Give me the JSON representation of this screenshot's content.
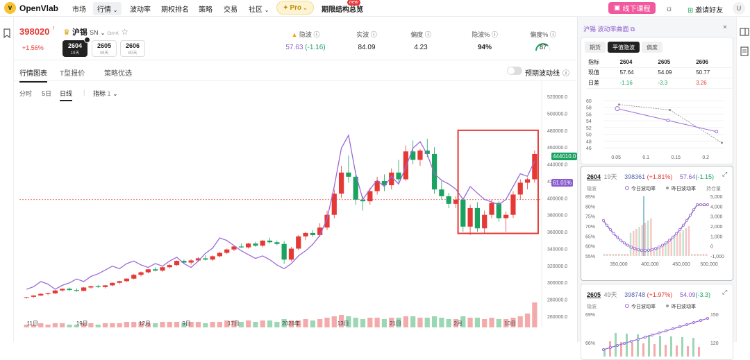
{
  "nav": {
    "logo_mark": "v",
    "logo": "OpenVlab",
    "items": [
      "市场",
      "行情",
      "波动率",
      "期权排名",
      "策略",
      "交易",
      "社区"
    ],
    "pro": "Pro",
    "special": "期限结构总览",
    "new_badge": "new",
    "course": "线下课程",
    "invite": "邀请好友",
    "avatar": "U"
  },
  "quote": {
    "price": "398020",
    "arrow": "↑",
    "change": "+1.56%",
    "symbol": "沪锡",
    "code": "SN",
    "hotkey": "Ctrl+K",
    "contracts": [
      {
        "code": "2604",
        "days": "19天"
      },
      {
        "code": "2605",
        "days": "49天"
      },
      {
        "code": "2606",
        "days": "80天"
      }
    ],
    "metrics": [
      {
        "label": "隐波",
        "value": "57.63",
        "delta": "(-1.16)"
      },
      {
        "label": "实波",
        "value": "84.09"
      },
      {
        "label": "偏度",
        "value": "4.23"
      },
      {
        "label": "隐波%",
        "value": "94%"
      },
      {
        "label": "偏度%",
        "value": "87"
      }
    ]
  },
  "tabs": [
    "行情图表",
    "T型报价",
    "策略优选"
  ],
  "toggle_label": "预期波动线",
  "timeframes": [
    "分时",
    "5日",
    "日线"
  ],
  "indicator": {
    "label": "指标",
    "count": "1"
  },
  "chart_data": {
    "type": "candlestick",
    "y_ticks": [
      "520000.0",
      "500000.0",
      "480000.0",
      "460000.0",
      "440000.0",
      "420000.0",
      "400000.0",
      "380000.0",
      "360000.0",
      "340000.0",
      "320000.0",
      "300000.0",
      "280000.0",
      "260000.0"
    ],
    "x_labels": [
      "11日",
      "19日",
      "12月",
      "9日",
      "17日",
      "2026年",
      "13日",
      "21日",
      "2月",
      "10日"
    ],
    "price_tag": "444010.0",
    "iv_tag": "61.01%",
    "ylim": [
      255000,
      525000
    ],
    "ref_price": 398020,
    "ohlc": [
      [
        282000,
        283000,
        281000,
        282500
      ],
      [
        283000,
        285000,
        282000,
        284500
      ],
      [
        284500,
        287000,
        284000,
        286500
      ],
      [
        286500,
        288000,
        285000,
        287000
      ],
      [
        287000,
        291000,
        286500,
        290500
      ],
      [
        290500,
        293000,
        289000,
        292500
      ],
      [
        292500,
        294000,
        290000,
        291000
      ],
      [
        291000,
        293000,
        289000,
        290000
      ],
      [
        290000,
        294500,
        289500,
        294000
      ],
      [
        294000,
        296000,
        292500,
        295500
      ],
      [
        295500,
        297000,
        293500,
        294500
      ],
      [
        294500,
        297000,
        293000,
        296500
      ],
      [
        296500,
        300000,
        295500,
        299500
      ],
      [
        299500,
        302000,
        298000,
        301500
      ],
      [
        301500,
        305000,
        300500,
        304500
      ],
      [
        304500,
        310000,
        303500,
        309000
      ],
      [
        309000,
        313000,
        307000,
        312000
      ],
      [
        312000,
        316000,
        310500,
        315500
      ],
      [
        315500,
        318000,
        313000,
        314000
      ],
      [
        314000,
        319000,
        312500,
        318000
      ],
      [
        318000,
        322000,
        316500,
        320500
      ],
      [
        320500,
        326000,
        319500,
        325500
      ],
      [
        325500,
        327000,
        322500,
        323500
      ],
      [
        323500,
        327500,
        321000,
        326000
      ],
      [
        326000,
        330000,
        324000,
        328500
      ],
      [
        328500,
        332000,
        326000,
        327000
      ],
      [
        327000,
        332000,
        325500,
        331000
      ],
      [
        331000,
        336000,
        329500,
        335000
      ],
      [
        335000,
        340000,
        333500,
        339000
      ],
      [
        339000,
        343500,
        337000,
        342500
      ],
      [
        342500,
        346000,
        340500,
        341500
      ],
      [
        341500,
        347000,
        340000,
        346000
      ],
      [
        346000,
        348000,
        342000,
        343500
      ],
      [
        343500,
        350000,
        341500,
        349500
      ],
      [
        349500,
        353000,
        346000,
        347500
      ],
      [
        347500,
        349500,
        344000,
        345500
      ],
      [
        345500,
        349000,
        322000,
        327000
      ],
      [
        327000,
        342000,
        325000,
        340000
      ],
      [
        340000,
        356000,
        338000,
        354500
      ],
      [
        354500,
        360000,
        350000,
        358500
      ],
      [
        358500,
        362000,
        354000,
        356000
      ],
      [
        356000,
        370000,
        354000,
        365000
      ],
      [
        365000,
        385000,
        362000,
        380000
      ],
      [
        380000,
        410000,
        376000,
        405000
      ],
      [
        405000,
        438000,
        400000,
        430000
      ],
      [
        430000,
        450000,
        418000,
        425000
      ],
      [
        425000,
        432000,
        392000,
        398000
      ],
      [
        398000,
        402000,
        385000,
        396000
      ],
      [
        396000,
        412000,
        392000,
        408000
      ],
      [
        408000,
        425000,
        404000,
        420000
      ],
      [
        420000,
        428000,
        408000,
        415000
      ],
      [
        415000,
        435000,
        410000,
        430000
      ],
      [
        430000,
        445000,
        418000,
        422000
      ],
      [
        422000,
        462000,
        420000,
        455000
      ],
      [
        455000,
        468000,
        440000,
        445000
      ],
      [
        445000,
        458000,
        438000,
        456000
      ],
      [
        456000,
        470000,
        448000,
        452000
      ],
      [
        452000,
        460000,
        405000,
        410000
      ],
      [
        410000,
        420000,
        398000,
        402000
      ],
      [
        402000,
        406000,
        388000,
        393000
      ],
      [
        393000,
        402000,
        388000,
        398000
      ],
      [
        398000,
        400000,
        360000,
        366000
      ],
      [
        366000,
        392000,
        356000,
        388000
      ],
      [
        388000,
        395000,
        360000,
        364000
      ],
      [
        364000,
        385000,
        358000,
        380000
      ],
      [
        380000,
        398000,
        376000,
        394000
      ],
      [
        394000,
        396000,
        372000,
        376000
      ],
      [
        376000,
        384000,
        360000,
        380000
      ],
      [
        380000,
        408000,
        376000,
        404000
      ],
      [
        404000,
        422000,
        398000,
        418000
      ],
      [
        418000,
        424000,
        410000,
        422000
      ],
      [
        422000,
        456000,
        418000,
        452000
      ]
    ],
    "volumes": [
      2,
      2,
      3,
      2,
      3,
      3,
      2,
      2,
      3,
      3,
      2,
      3,
      3,
      3,
      4,
      4,
      4,
      3,
      3,
      4,
      4,
      4,
      3,
      4,
      4,
      3,
      4,
      4,
      5,
      5,
      4,
      5,
      4,
      5,
      5,
      4,
      6,
      5,
      5,
      6,
      5,
      6,
      7,
      8,
      9,
      8,
      7,
      6,
      7,
      7,
      6,
      7,
      7,
      8,
      8,
      7,
      7,
      8,
      7,
      6,
      6,
      8,
      7,
      7,
      6,
      7,
      6,
      6,
      7,
      8,
      10,
      18
    ],
    "iv_line": [
      30,
      32,
      36,
      34,
      30,
      33,
      35,
      38,
      36,
      40,
      42,
      45,
      48,
      46,
      50,
      52,
      49,
      47,
      50,
      48,
      52,
      55,
      50,
      47,
      52,
      58,
      62,
      70,
      68,
      64,
      60,
      57,
      54,
      56,
      53,
      49,
      46,
      50,
      56,
      60,
      65,
      72,
      85,
      110,
      140,
      150,
      120,
      100,
      108,
      115,
      110,
      118,
      112,
      125,
      140,
      145,
      135,
      120,
      115,
      112,
      108,
      100,
      110,
      105,
      100,
      98,
      96,
      100,
      110,
      120,
      118,
      130
    ]
  },
  "panel": {
    "title": "沪锡 波动率曲面",
    "tabs": [
      "期货",
      "平值隐波",
      "偏度"
    ],
    "table": {
      "headers": [
        "指标",
        "2604",
        "2605",
        "2606"
      ],
      "rows": [
        [
          "现值",
          "57.64",
          "54.09",
          "50.77"
        ],
        [
          "日差",
          "-1.16",
          "-3.3",
          "3.26"
        ]
      ]
    },
    "mini_chart": {
      "type": "line",
      "x_ticks": [
        "0.05",
        "0.1",
        "0.15",
        "0.2"
      ],
      "y_ticks": [
        "60",
        "58",
        "56",
        "54",
        "52",
        "50",
        "48",
        "46"
      ],
      "series": [
        {
          "values": [
            57.6,
            54.1,
            50.8
          ]
        },
        {
          "values": [
            58.8,
            57.2,
            47.5
          ]
        }
      ]
    },
    "cards": [
      {
        "code": "2604",
        "days": "19天",
        "price": "398361",
        "pct": "(+1.81%)",
        "iv": "57.64",
        "ivd": "(-1.15)",
        "legend": [
          "今日波动率",
          "昨日波动率"
        ],
        "side": "持仓量",
        "y_left": [
          "85%",
          "80%",
          "75%",
          "70%",
          "65%",
          "60%",
          "55%"
        ],
        "y_right": [
          "5,000",
          "4,000",
          "3,000",
          "2,000",
          "1,000",
          "0",
          "-1,000"
        ],
        "x": [
          "350,000",
          "400,000",
          "450,000",
          "500,000"
        ]
      },
      {
        "code": "2605",
        "days": "49天",
        "price": "398748",
        "pct": "(+1.97%)",
        "iv": "54.09",
        "ivd": "(-3.3)",
        "legend": [
          "今日波动率",
          "昨日波动率"
        ],
        "y_left": [
          "69%",
          "66%"
        ],
        "y_right": [
          "150",
          "120"
        ]
      }
    ]
  }
}
